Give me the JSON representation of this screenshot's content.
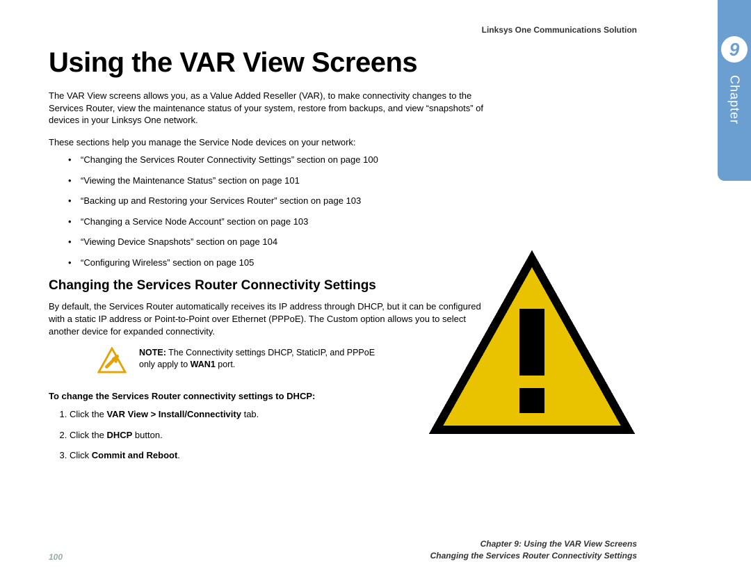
{
  "header": {
    "product_line": "Linksys One Communications Solution"
  },
  "sidetab": {
    "chapter_number": "9",
    "chapter_word": "Chapter"
  },
  "chapter": {
    "title": "Using the VAR View Screens"
  },
  "intro": {
    "p1": "The VAR View screens allows you, as a Value Added Reseller (VAR), to make connectivity changes to the Services Router, view the maintenance status of your system, restore from backups, and view “snapshots” of devices in your Linksys One network.",
    "p2": "These sections help you manage the Service Node devices on your network:"
  },
  "toc": [
    "“Changing the Services Router Connectivity Settings” section on page 100",
    "“Viewing the Maintenance Status” section on page 101",
    "“Backing up and Restoring your Services Router” section on page 103",
    "“Changing a Service Node Account” section on page 103",
    "“Viewing Device Snapshots” section on page 104",
    "“Configuring Wireless” section on page 105"
  ],
  "section1": {
    "heading": "Changing the Services Router Connectivity Settings",
    "body": "By default, the Services Router automatically receives its IP address through DHCP, but it can be configured with a static IP address or Point-to-Point over Ethernet (PPPoE). The Custom option allows you to select another device for expanded connectivity."
  },
  "note": {
    "label": "NOTE:",
    "text_before_bold": " The Connectivity settings DHCP, StaticIP, and PPPoE only apply to ",
    "bold": "WAN1",
    "text_after_bold": " port."
  },
  "procedure": {
    "heading": "To change the Services Router connectivity settings to DHCP:",
    "steps": [
      {
        "pre": "Click the ",
        "bold": "VAR View > Install/Connectivity",
        "post": " tab."
      },
      {
        "pre": "Click the ",
        "bold": "DHCP",
        "post": " button."
      },
      {
        "pre": "Click ",
        "bold": "Commit and Reboot",
        "post": "."
      }
    ]
  },
  "footer": {
    "page_number": "100",
    "line1": "Chapter 9: Using the VAR View Screens",
    "line2": "Changing the Services Router Connectivity Settings"
  }
}
